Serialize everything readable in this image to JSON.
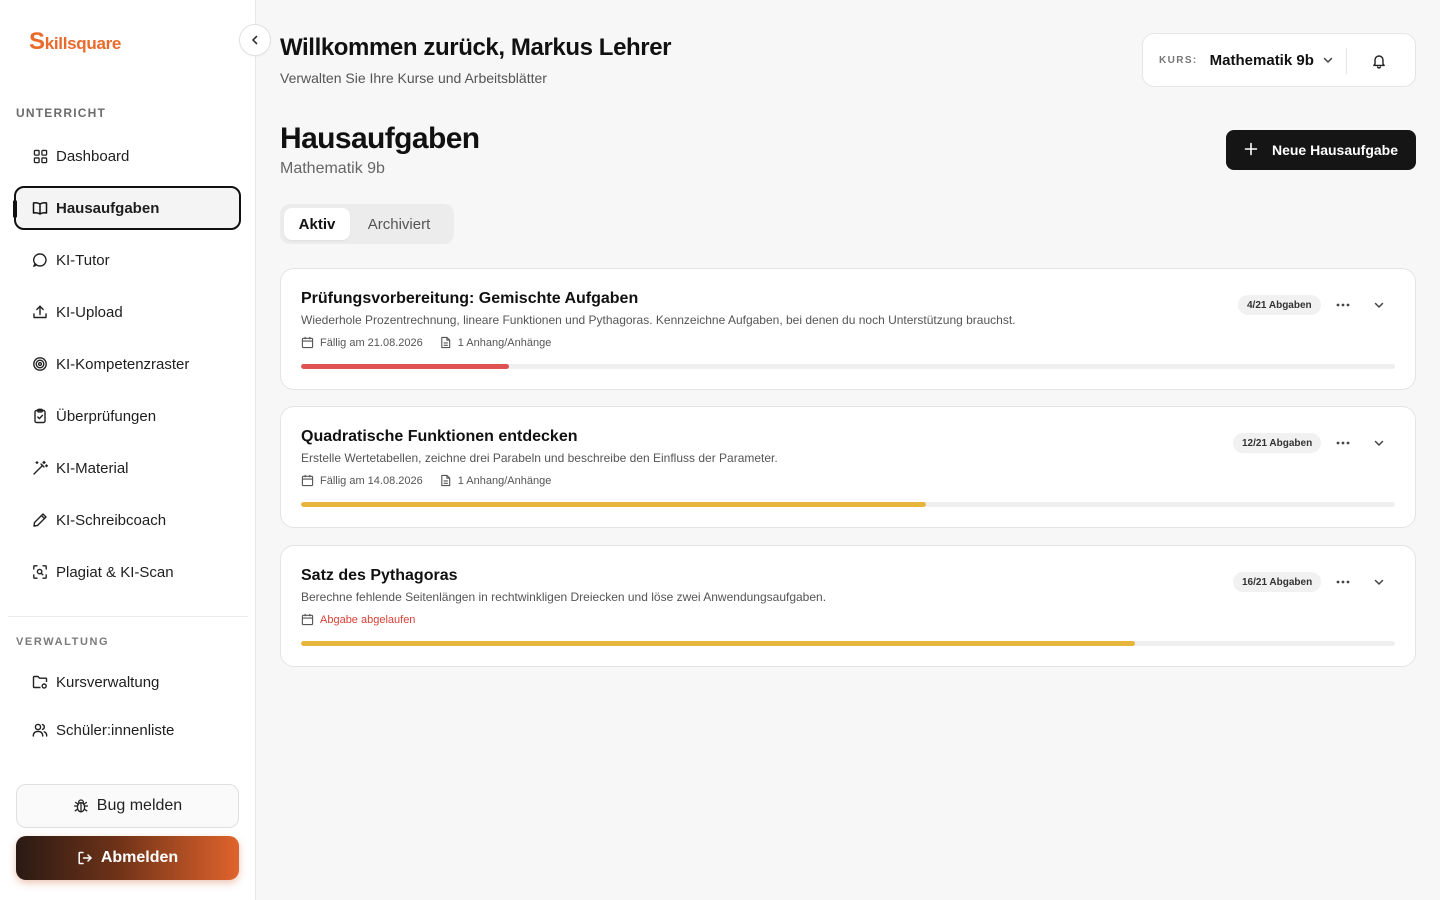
{
  "brand": {
    "logo_initial": "S",
    "logo_rest": "killsquare",
    "accent": "#ea6a2c"
  },
  "sidebar": {
    "section_teaching": "UNTERRICHT",
    "items": [
      {
        "label": "Dashboard",
        "icon": "grid-icon"
      },
      {
        "label": "Hausaufgaben",
        "icon": "book-icon",
        "active": true
      },
      {
        "label": "KI-Tutor",
        "icon": "chat-icon"
      },
      {
        "label": "KI-Upload",
        "icon": "upload-icon"
      },
      {
        "label": "KI-Kompetenzraster",
        "icon": "target-icon"
      },
      {
        "label": "Überprüfungen",
        "icon": "clipboard-icon"
      },
      {
        "label": "KI-Material",
        "icon": "magic-wand-icon"
      },
      {
        "label": "KI-Schreibcoach",
        "icon": "pen-icon"
      },
      {
        "label": "Plagiat & KI-Scan",
        "icon": "scan-icon"
      }
    ],
    "section_admin": "VERWALTUNG",
    "admin_items": [
      {
        "label": "Kursverwaltung",
        "icon": "folder-settings-icon"
      },
      {
        "label": "Schüler:innenliste",
        "icon": "users-icon"
      }
    ],
    "bug_label": "Bug melden",
    "logout_label": "Abmelden"
  },
  "header": {
    "welcome": "Willkommen zurück, Markus Lehrer",
    "subtitle": "Verwalten Sie Ihre Kurse und Arbeitsblätter",
    "course_label": "KURS:",
    "course_value": "Mathematik 9b"
  },
  "main": {
    "title": "Hausaufgaben",
    "subtitle": "Mathematik 9b",
    "new_button": "Neue Hausaufgabe",
    "tabs": [
      {
        "label": "Aktiv"
      },
      {
        "label": "Archiviert"
      }
    ],
    "assignments": [
      {
        "title": "Prüfungsvorbereitung: Gemischte Aufgaben",
        "description": "Wiederhole Prozentrechnung, lineare Funktionen und Pythagoras. Kennzeichne Aufgaben, bei denen du noch Unterstützung brauchst.",
        "due": "Fällig am 21.08.2026",
        "attachments": "1 Anhang/Anhänge",
        "submissions": "4/21 Abgaben",
        "progress": 0.19,
        "bar_color": "#e05252"
      },
      {
        "title": "Quadratische Funktionen entdecken",
        "description": "Erstelle Wertetabellen, zeichne drei Parabeln und beschreibe den Einfluss der Parameter.",
        "due": "Fällig am 14.08.2026",
        "attachments": "1 Anhang/Anhänge",
        "submissions": "12/21 Abgaben",
        "progress": 0.571,
        "bar_color": "#e8b53c"
      },
      {
        "title": "Satz des Pythagoras",
        "description": "Berechne fehlende Seitenlängen in rechtwinkligen Dreiecken und löse zwei Anwendungsaufgaben.",
        "due": "Abgabe abgelaufen",
        "submissions": "16/21 Abgaben",
        "progress": 0.762,
        "bar_color": "#e8b53c",
        "overdue_color": "#d9413a"
      }
    ]
  }
}
